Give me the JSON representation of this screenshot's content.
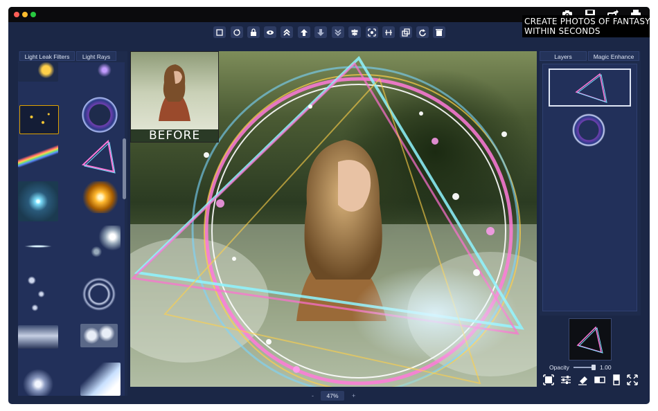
{
  "promo": {
    "line1": "CREATE PHOTOS OF FANTASY",
    "line2": "WITHIN SECONDS"
  },
  "left_tabs": [
    "Light Leak Filters",
    "Light Rays"
  ],
  "right_tabs": [
    "Layers",
    "Magic Enhance"
  ],
  "before_label": "BEFORE",
  "zoom": {
    "value": "47%",
    "minus": "-",
    "plus": "+"
  },
  "opacity": {
    "label": "Opacity",
    "value": "1.00"
  },
  "colors": {
    "window": "#1b2746",
    "panel": "#1e2b4c",
    "selection": "#e0a300"
  },
  "toolbar_icons": [
    "crop-icon",
    "rotate-icon",
    "lock-icon",
    "eye-icon",
    "bring-to-front-icon",
    "move-up-icon",
    "move-down-icon",
    "send-to-back-icon",
    "align-center-icon",
    "center-icon",
    "distribute-icon",
    "duplicate-icon",
    "redo-icon",
    "trash-icon"
  ],
  "top_right_icons": [
    "camera-icon",
    "save-icon",
    "share-icon",
    "print-icon"
  ],
  "layer_tool_icons": [
    "fit-icon",
    "adjust-icon",
    "eraser-icon",
    "mask-icon",
    "fill-icon",
    "fullscreen-icon"
  ]
}
